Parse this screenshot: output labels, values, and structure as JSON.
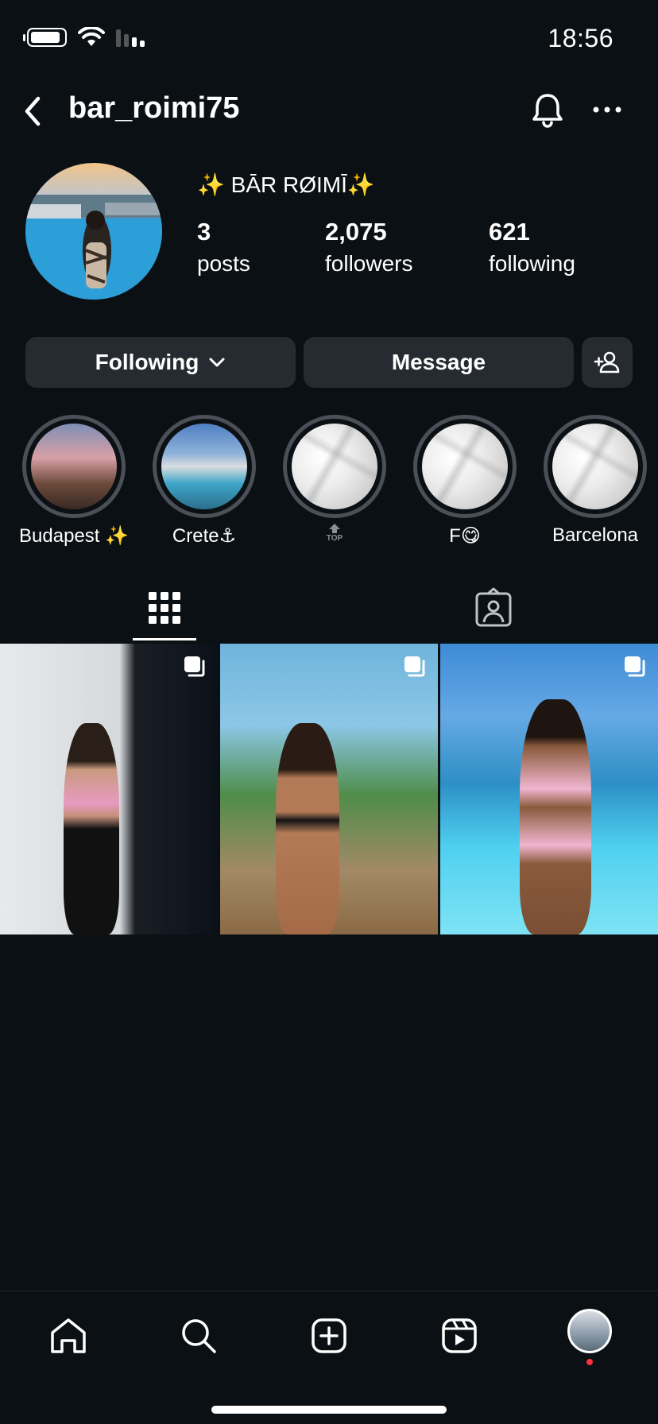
{
  "status": {
    "time": "18:56"
  },
  "header": {
    "username": "bar_roimi75"
  },
  "profile": {
    "display_name": "✨ BĀR RØIMĪ✨",
    "stats": [
      {
        "value": "3",
        "label": "posts"
      },
      {
        "value": "2,075",
        "label": "followers"
      },
      {
        "value": "621",
        "label": "following"
      }
    ]
  },
  "actions": {
    "following": "Following",
    "message": "Message"
  },
  "highlights": [
    {
      "label": "Budapest ✨"
    },
    {
      "label": "Crete⚓"
    },
    {
      "label": "TOP"
    },
    {
      "label": "F😋"
    },
    {
      "label": "Barcelona"
    }
  ],
  "icons": {
    "back": "chevron-left-icon",
    "bell": "bell-icon",
    "more": "more-horizontal-icon",
    "add_person": "add-person-icon",
    "grid": "grid-icon",
    "tagged": "tagged-icon",
    "multi": "multiple-posts-icon",
    "home": "home-icon",
    "search": "search-icon",
    "create": "create-icon",
    "reels": "reels-icon"
  },
  "colors": {
    "background": "#0b1014",
    "button": "#262b31",
    "notification_dot": "#ff3040"
  }
}
